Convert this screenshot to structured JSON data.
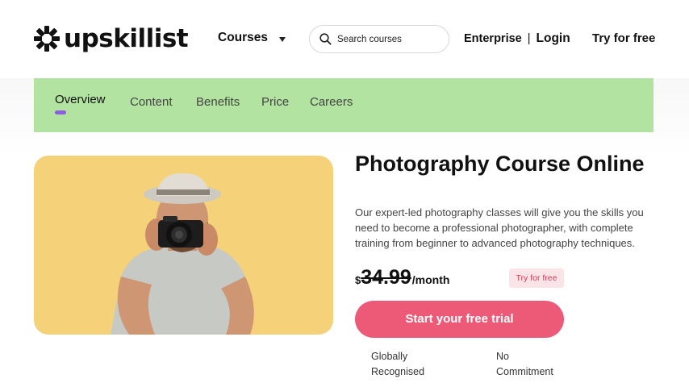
{
  "header": {
    "logo_text": "upskillist",
    "courses_label": "Courses",
    "search_placeholder": "Search courses",
    "enterprise_label": "Enterprise",
    "separator": "|",
    "login_label": "Login",
    "try_label": "Try for free"
  },
  "subnav": {
    "items": [
      "Overview",
      "Content",
      "Benefits",
      "Price",
      "Careers"
    ],
    "active": "Overview",
    "background": "#b2e3a0",
    "active_indicator_color": "#8d5ee0"
  },
  "hero": {
    "title": "Photography Course Online",
    "description": "Our expert-led photography classes will give you the skills you need to become a professional photographer, with complete training from beginner to advanced photography techniques.",
    "image_background": "#f5d27a"
  },
  "pricing": {
    "currency": "$",
    "amount": "34.99",
    "period": "/month",
    "badge": "Try for free",
    "cta_label": "Start your free trial",
    "cta_color": "#ec5a78"
  },
  "features": [
    "Globally Recognised",
    "No Commitment"
  ]
}
